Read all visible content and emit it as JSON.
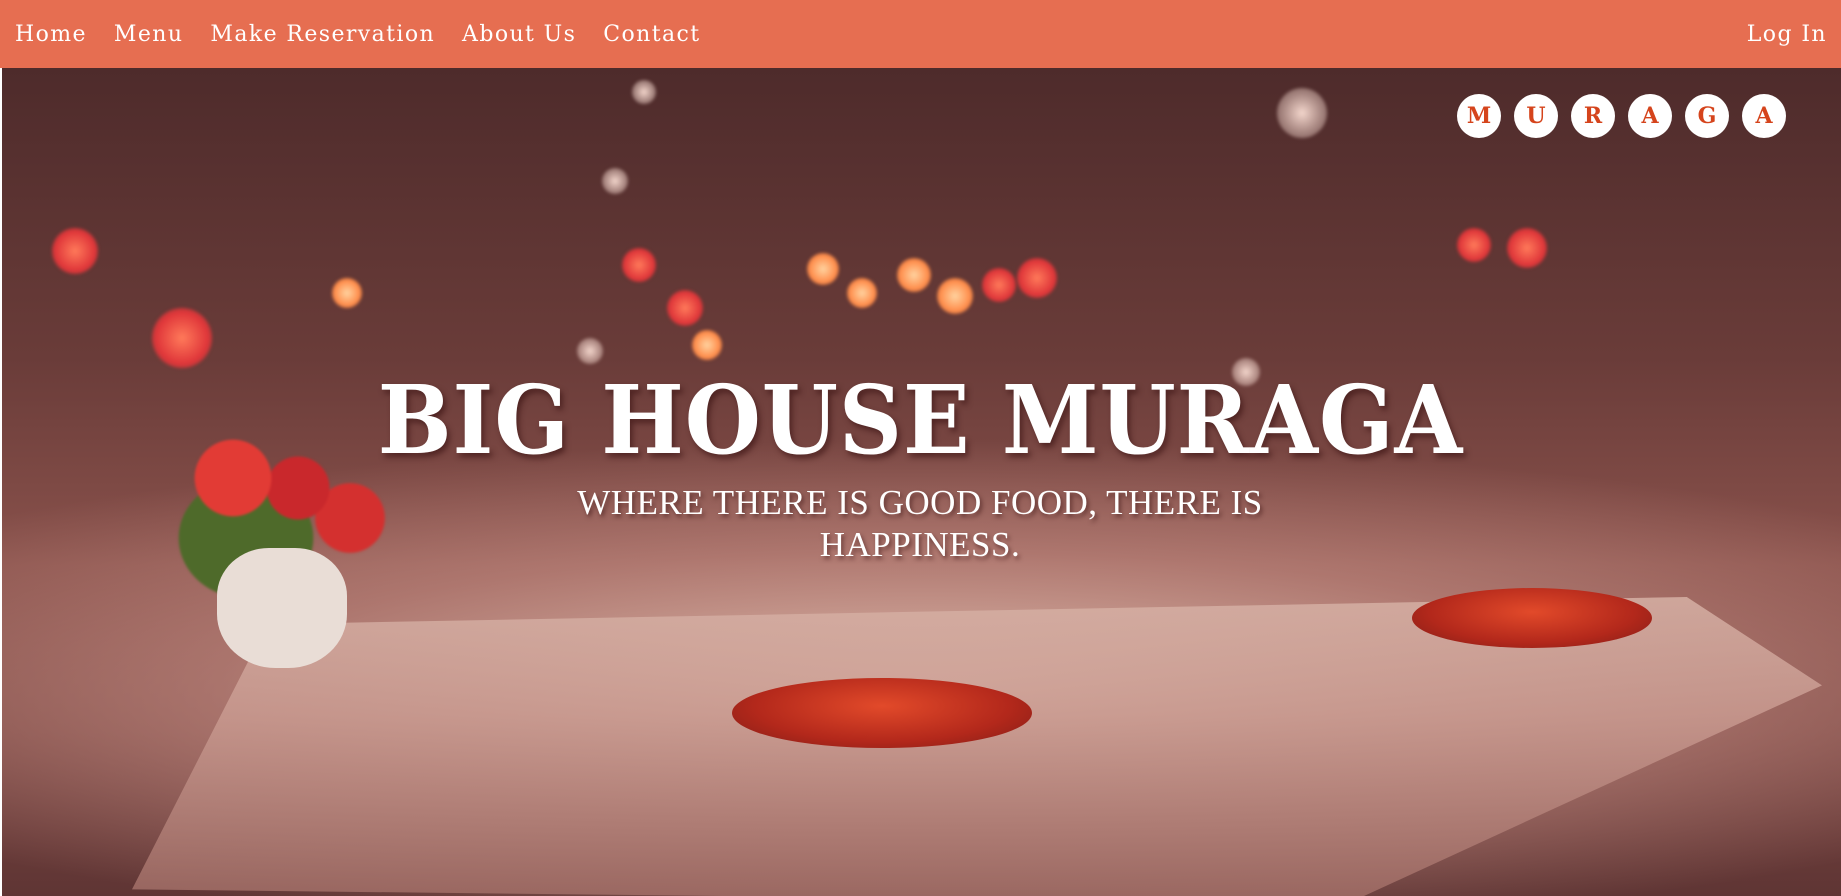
{
  "navbar": {
    "links": [
      "Home",
      "Menu",
      "Make Reservation",
      "About Us",
      "Contact"
    ],
    "login_label": "Log In",
    "background": "#e66e51"
  },
  "brand": {
    "letters": [
      "M",
      "U",
      "R",
      "A",
      "G",
      "A"
    ],
    "letter_color": "#d5441c"
  },
  "hero": {
    "title": "BIG HOUSE MURAGA",
    "subtitle": "WHERE THERE IS GOOD FOOD, THERE IS HAPPINESS.",
    "background_icon": "restaurant-table-photo"
  }
}
